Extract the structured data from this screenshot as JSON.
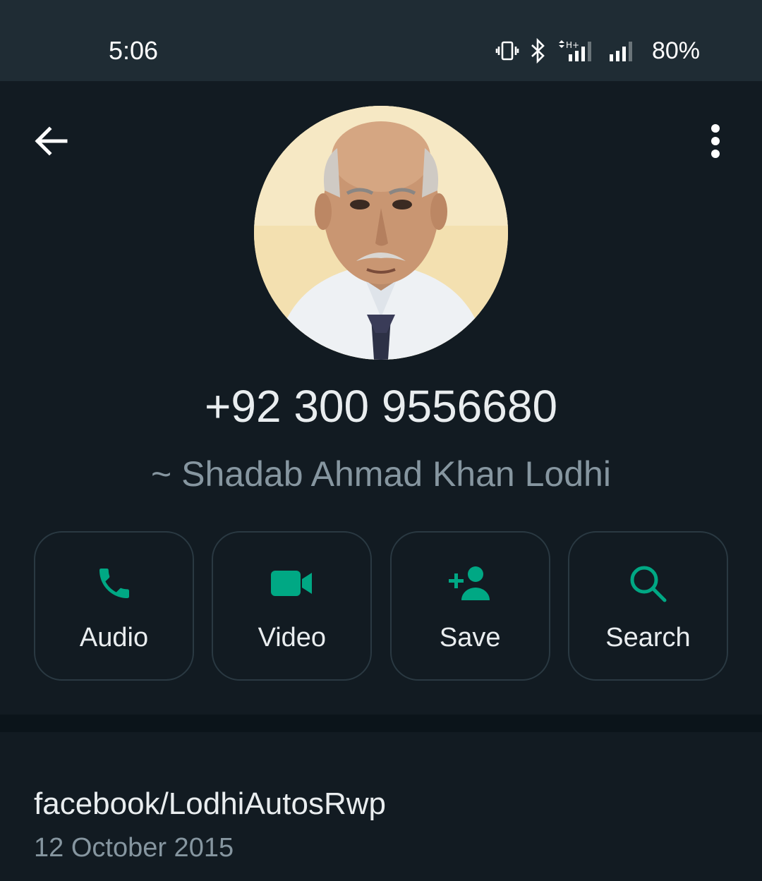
{
  "status_bar": {
    "time": "5:06",
    "battery": "80%",
    "icons": [
      "vibrate-icon",
      "bluetooth-icon",
      "mobile-data-hplus-signal-icon",
      "signal-icon",
      "battery-text"
    ]
  },
  "toolbar": {
    "back_icon": "arrow-left-icon",
    "menu_icon": "more-vertical-icon"
  },
  "contact": {
    "phone": "+92 300 9556680",
    "push_name": "~ Shadab Ahmad Khan Lodhi"
  },
  "actions": [
    {
      "label": "Audio",
      "icon": "phone-icon"
    },
    {
      "label": "Video",
      "icon": "video-camera-icon"
    },
    {
      "label": "Save",
      "icon": "add-person-icon"
    },
    {
      "label": "Search",
      "icon": "search-icon"
    }
  ],
  "about": {
    "text": "facebook/LodhiAutosRwp",
    "date": "12 October 2015"
  },
  "colors": {
    "accent": "#00a884",
    "background": "#121b22",
    "status_bar": "#1f2c34",
    "primary_text": "#e9edef",
    "secondary_text": "#8696a0"
  }
}
